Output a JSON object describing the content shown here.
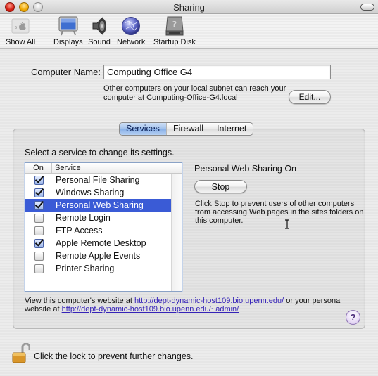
{
  "window": {
    "title": "Sharing"
  },
  "toolbar": {
    "items": [
      {
        "label": "Show All",
        "icon": "apple-grid-icon"
      },
      {
        "label": "Displays",
        "icon": "display-icon"
      },
      {
        "label": "Sound",
        "icon": "speaker-icon"
      },
      {
        "label": "Network",
        "icon": "network-globe-icon"
      },
      {
        "label": "Startup Disk",
        "icon": "hard-disk-icon"
      }
    ]
  },
  "computer_name": {
    "label": "Computer Name:",
    "value": "Computing Office G4",
    "help_line1": "Other computers on your local subnet can reach your",
    "help_line2": "computer at Computing-Office-G4.local",
    "edit_label": "Edit..."
  },
  "tabs": [
    {
      "label": "Services",
      "active": true
    },
    {
      "label": "Firewall",
      "active": false
    },
    {
      "label": "Internet",
      "active": false
    }
  ],
  "services": {
    "instruction": "Select a service to change its settings.",
    "columns": {
      "on": "On",
      "service": "Service"
    },
    "rows": [
      {
        "name": "Personal File Sharing",
        "on": true,
        "selected": false
      },
      {
        "name": "Windows Sharing",
        "on": true,
        "selected": false
      },
      {
        "name": "Personal Web Sharing",
        "on": true,
        "selected": true
      },
      {
        "name": "Remote Login",
        "on": false,
        "selected": false
      },
      {
        "name": "FTP Access",
        "on": false,
        "selected": false
      },
      {
        "name": "Apple Remote Desktop",
        "on": true,
        "selected": false
      },
      {
        "name": "Remote Apple Events",
        "on": false,
        "selected": false
      },
      {
        "name": "Printer Sharing",
        "on": false,
        "selected": false
      }
    ]
  },
  "status": {
    "title": "Personal Web Sharing On",
    "button_label": "Stop",
    "description": "Click Stop to prevent users of other computers from accessing Web pages in the sites folders on this computer."
  },
  "web": {
    "prefix": "View this computer's website at ",
    "computer_url": "http://dept-dynamic-host109.bio.upenn.edu/",
    "middle": " or your personal website at ",
    "personal_url": "http://dept-dynamic-host109.bio.upenn.edu/~admin/"
  },
  "help": {
    "label": "?"
  },
  "lock": {
    "text": "Click the lock to prevent further changes."
  }
}
